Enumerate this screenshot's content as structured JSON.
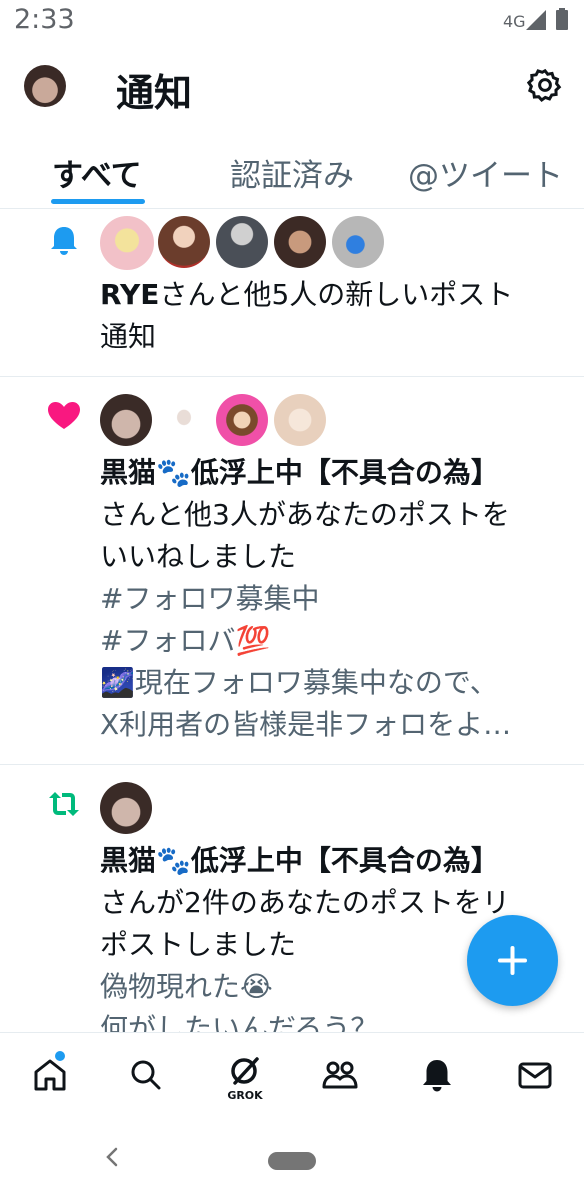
{
  "status_bar": {
    "time": "2:33",
    "network": "4G"
  },
  "header": {
    "title": "通知"
  },
  "tabs": [
    {
      "label": "すべて",
      "active": true
    },
    {
      "label": "認証済み",
      "active": false
    },
    {
      "label": "@ツイート",
      "active": false
    }
  ],
  "notifications": [
    {
      "type": "new-post",
      "type_icon": "bell-icon",
      "avatars": 5,
      "name": "RYE",
      "text": "さんと他5人の新しいポスト",
      "text2": "通知"
    },
    {
      "type": "like",
      "type_icon": "heart-icon",
      "avatars": 4,
      "name": "黒猫🐾低浮上中【不具合の為】",
      "text": "さんと他3人があなたのポストを",
      "text2": "いいねしました",
      "body": [
        "#フォロワ募集中",
        "#フォロバ💯",
        "🌌現在フォロワ募集中なので、",
        "X利用者の皆様是非フォロをよ…"
      ]
    },
    {
      "type": "repost",
      "type_icon": "repost-icon",
      "avatars": 1,
      "name": "黒猫🐾低浮上中【不具合の為】",
      "text": "さんが2件のあなたのポストをリ",
      "text2": "ポストしました",
      "body": [
        "偽物現れた😭",
        "何がしたいんだろう？"
      ]
    }
  ],
  "bottom_nav": {
    "items": [
      "home-icon",
      "search-icon",
      "grok-icon",
      "communities-icon",
      "notifications-icon",
      "messages-icon"
    ],
    "grok_label": "GROK"
  },
  "colors": {
    "accent": "#1d9bf0",
    "like": "#f91880",
    "repost": "#00ba7c"
  }
}
